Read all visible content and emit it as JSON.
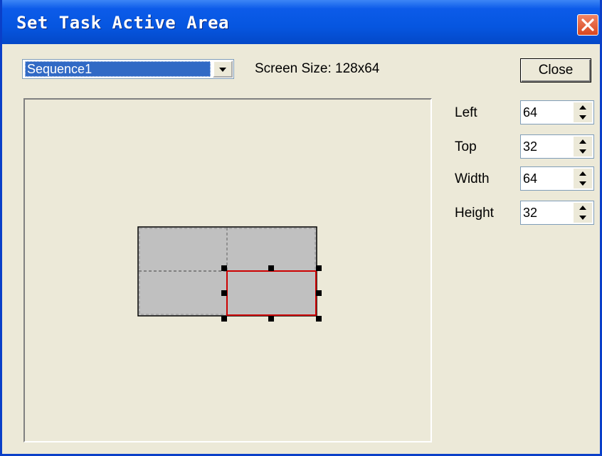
{
  "window": {
    "title": "Set Task Active Area"
  },
  "sequence_select": {
    "value": "Sequence1"
  },
  "screen_size": {
    "text": "Screen Size: 128x64"
  },
  "close_button": {
    "label": "Close"
  },
  "fields": [
    {
      "label": "Left",
      "value": "64"
    },
    {
      "label": "Top",
      "value": "32"
    },
    {
      "label": "Width",
      "value": "64"
    },
    {
      "label": "Height",
      "value": "32"
    }
  ],
  "colors": {
    "titlebar": "#0656e0",
    "selection": "#316ac5",
    "active_area_border": "#cc0000",
    "area_fill": "#c0c0c0"
  },
  "icons": {
    "title_close": "close-icon",
    "dropdown": "chevron-down-icon",
    "spin": "spin-arrows-icon"
  }
}
